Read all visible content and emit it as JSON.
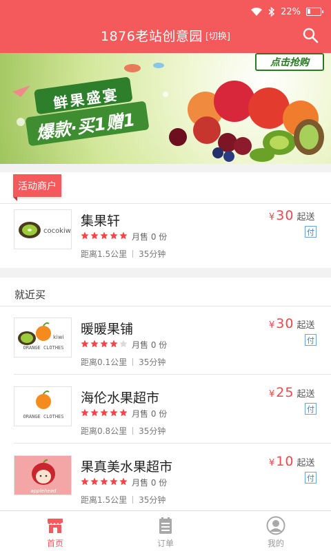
{
  "status_bar": {
    "battery": "22%"
  },
  "header": {
    "title": "1876老站创意园",
    "switch_label": "[切换]"
  },
  "banner": {
    "headline": "鲜果盛宴",
    "subline": "爆款·买1赠1",
    "cta": "点击抢购"
  },
  "active_section": {
    "tag": "活动商户",
    "stores": [
      {
        "name": "集果轩",
        "logo_text": "cocokiwi",
        "rating": 5,
        "sales": "月售 0 份",
        "distance": "距离1.5公里",
        "time": "35分钟",
        "currency": "¥",
        "price": "30",
        "price_label": "起送",
        "pay_badge": "付"
      }
    ]
  },
  "near_section": {
    "title": "就近买",
    "stores": [
      {
        "name": "暖暖果铺",
        "logo_text": "ORANGE CLOTHES",
        "rating": 4,
        "sales": "月售 0 份",
        "distance": "距离0.1公里",
        "time": "35分钟",
        "currency": "¥",
        "price": "30",
        "price_label": "起送",
        "pay_badge": "付"
      },
      {
        "name": "海伦水果超市",
        "logo_text": "ORANGE CLOTHES",
        "rating": 5,
        "sales": "月售 0 份",
        "distance": "距离0.8公里",
        "time": "35分钟",
        "currency": "¥",
        "price": "25",
        "price_label": "起送",
        "pay_badge": "付"
      },
      {
        "name": "果真美水果超市",
        "logo_text": "applehead",
        "rating": 5,
        "sales": "月售 0 份",
        "distance": "距离1.5公里",
        "time": "35分钟",
        "currency": "¥",
        "price": "10",
        "price_label": "起送",
        "pay_badge": "付"
      }
    ]
  },
  "bottom_nav": {
    "items": [
      {
        "label": "首页",
        "icon": "store-icon",
        "active": true
      },
      {
        "label": "订单",
        "icon": "order-list-icon",
        "active": false
      },
      {
        "label": "我的",
        "icon": "user-icon",
        "active": false
      }
    ]
  },
  "colors": {
    "primary": "#f4595c",
    "price": "#f2464a",
    "star": "#f2464a",
    "pay_badge": "#3d84d8"
  }
}
